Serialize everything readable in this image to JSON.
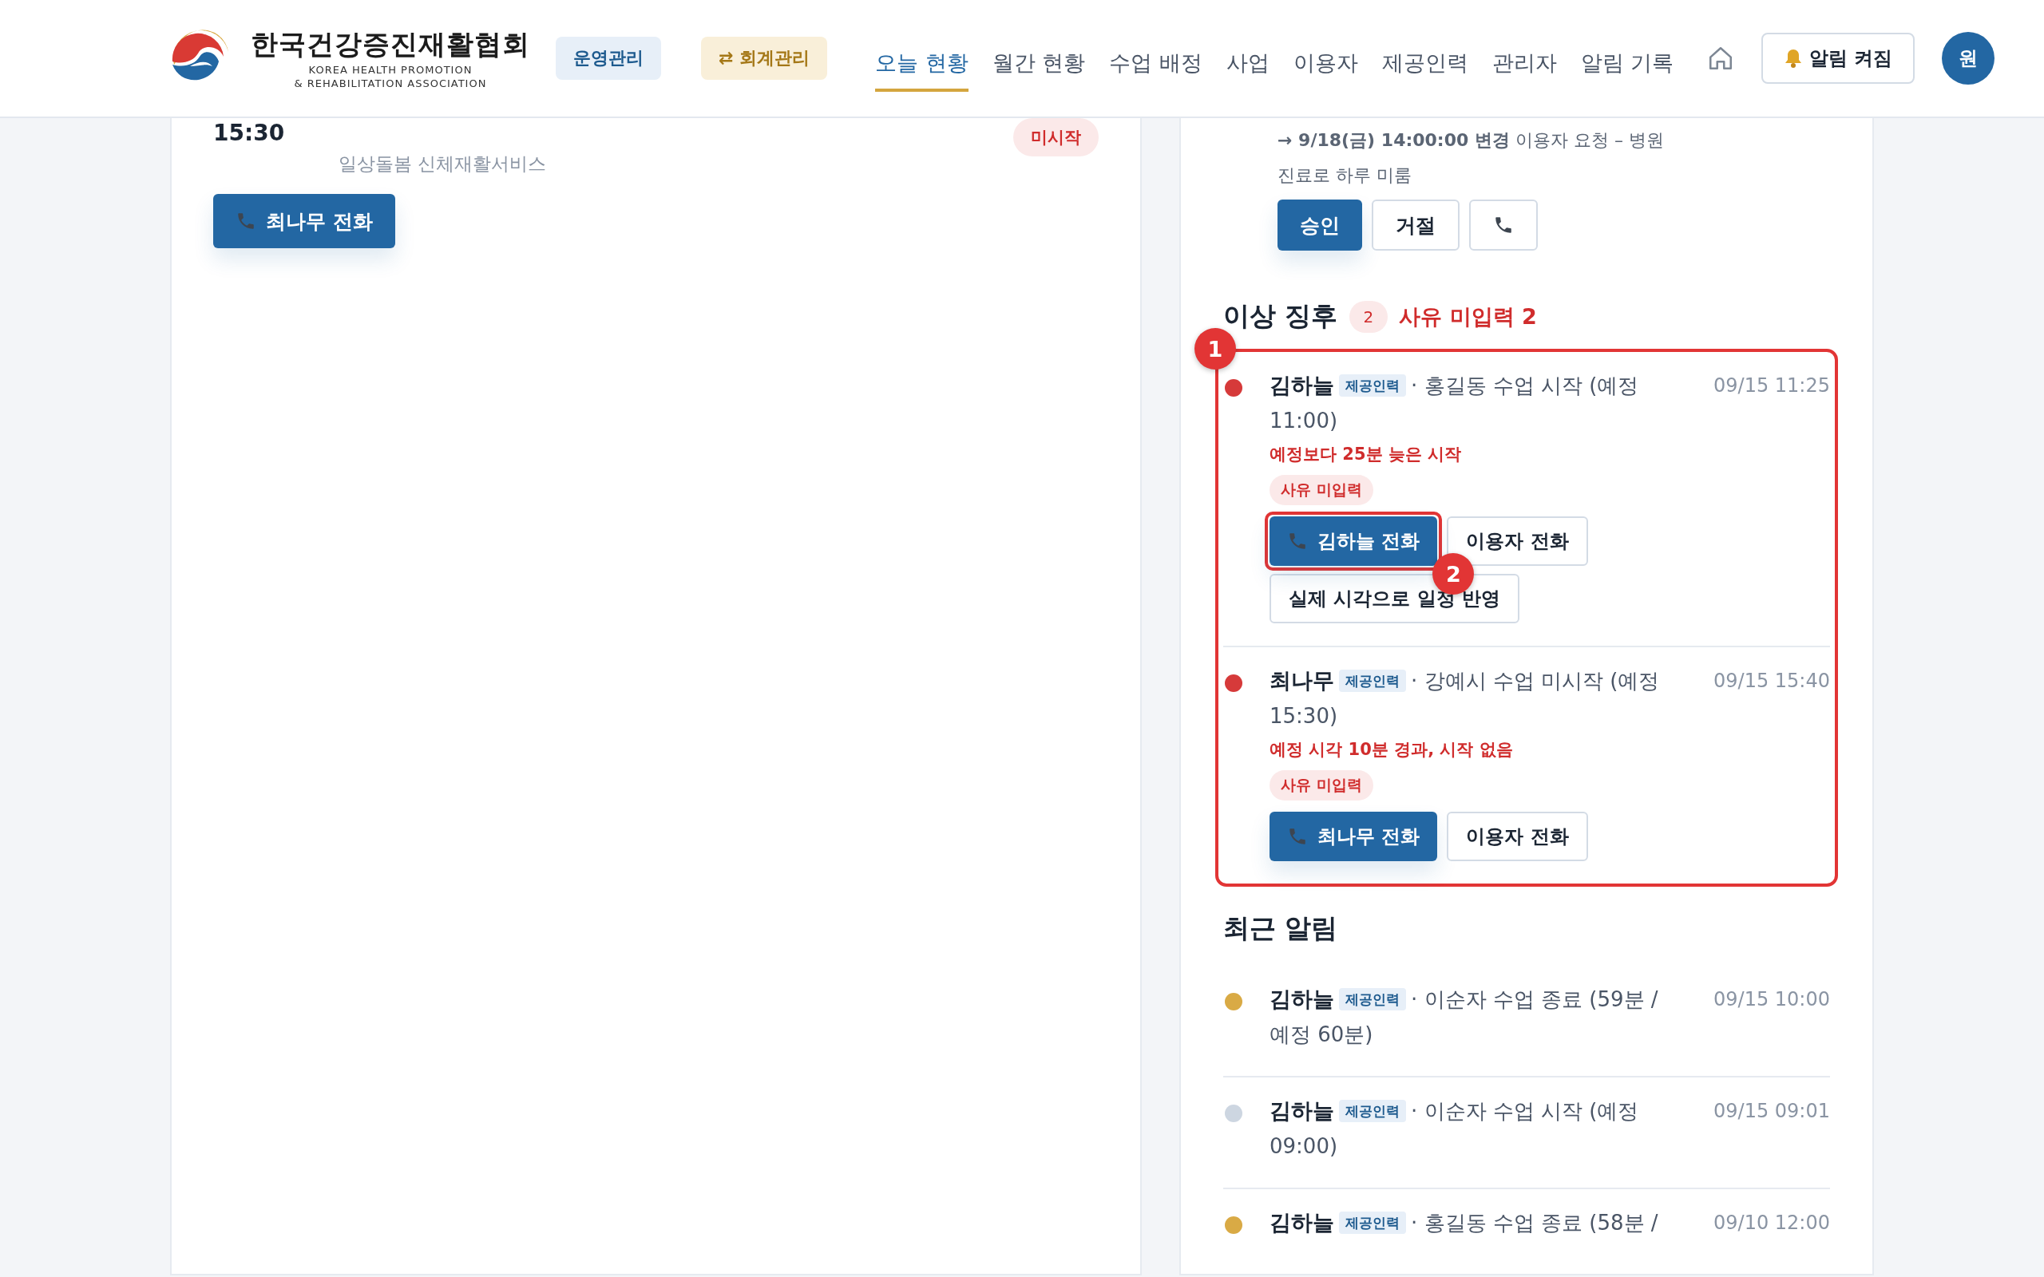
{
  "header": {
    "org_name": "한국건강증진재활협회",
    "org_name_en": [
      "KOREA HEALTH PROMOTION",
      "& REHABILITATION ASSOCIATION"
    ],
    "mode_buttons": [
      {
        "label": "운영관리",
        "kind": "blue"
      },
      {
        "label": "⇄ 회계관리",
        "kind": "gold"
      }
    ],
    "nav": [
      {
        "label": "오늘 현황",
        "selected": true
      },
      {
        "label": "월간 현황",
        "selected": false
      },
      {
        "label": "수업 배정",
        "selected": false
      },
      {
        "label": "사업",
        "selected": false
      },
      {
        "label": "이용자",
        "selected": false
      },
      {
        "label": "제공인력",
        "selected": false
      },
      {
        "label": "관리자",
        "selected": false
      },
      {
        "label": "알림 기록",
        "selected": false
      }
    ],
    "alert_button": "알림 켜짐",
    "avatar": "원"
  },
  "schedule_card": {
    "time": "15:30",
    "service": "일상돌봄 신체재활서비스",
    "status": "미시작",
    "call_button": "최나무 전화"
  },
  "change_request": {
    "text": "**→ 9/18(금) 14:00:00 변경** 이용자 요청 – 병원 진료로 하루 미룸",
    "buttons": [
      {
        "kind": "primary",
        "label": "승인"
      },
      {
        "kind": "secondary",
        "label": "거절"
      },
      {
        "kind": "phone"
      }
    ]
  },
  "anomalies": {
    "title": "이상 징후",
    "count": "2",
    "missing": "사유 미입력 2",
    "annotation": "1",
    "items": [
      {
        "color": "#d63a3a",
        "name": "김하늘",
        "role": "제공인력",
        "text": "· 홍길동 수업 시작 (예정 11:00)",
        "time": "09/15 11:25",
        "warning": "예정보다 25분 늦은 시작",
        "badge": "사유 미입력",
        "buttons": [
          {
            "kind": "primary",
            "label": "김하늘 전화",
            "annotation": "2"
          },
          {
            "kind": "secondary",
            "label": "이용자 전화"
          },
          {
            "kind": "secondary",
            "label": "실제 시각으로 일정 반영"
          }
        ]
      },
      {
        "color": "#d63a3a",
        "name": "최나무",
        "role": "제공인력",
        "text": "· 강예시 수업 미시작 (예정 15:30)",
        "time": "09/15 15:40",
        "warning": "예정 시각 10분 경과, 시작 없음",
        "badge": "사유 미입력",
        "buttons": [
          {
            "kind": "primary",
            "label": "최나무 전화"
          },
          {
            "kind": "secondary",
            "label": "이용자 전화"
          }
        ]
      }
    ]
  },
  "recent": {
    "title": "최근 알림",
    "items": [
      {
        "color": "#d9aa45",
        "name": "김하늘",
        "role": "제공인력",
        "text": "· 이순자 수업 종료 (59분 / 예정 60분)",
        "time": "09/15 10:00"
      },
      {
        "color": "#cdd6e1",
        "name": "김하늘",
        "role": "제공인력",
        "text": "· 이순자 수업 시작 (예정 09:00)",
        "time": "09/15 09:01"
      },
      {
        "color": "#d9aa45",
        "name": "김하늘",
        "role": "제공인력",
        "text": "· 홍길동 수업 종료 (58분 /",
        "time": "09/10 12:00"
      }
    ]
  }
}
